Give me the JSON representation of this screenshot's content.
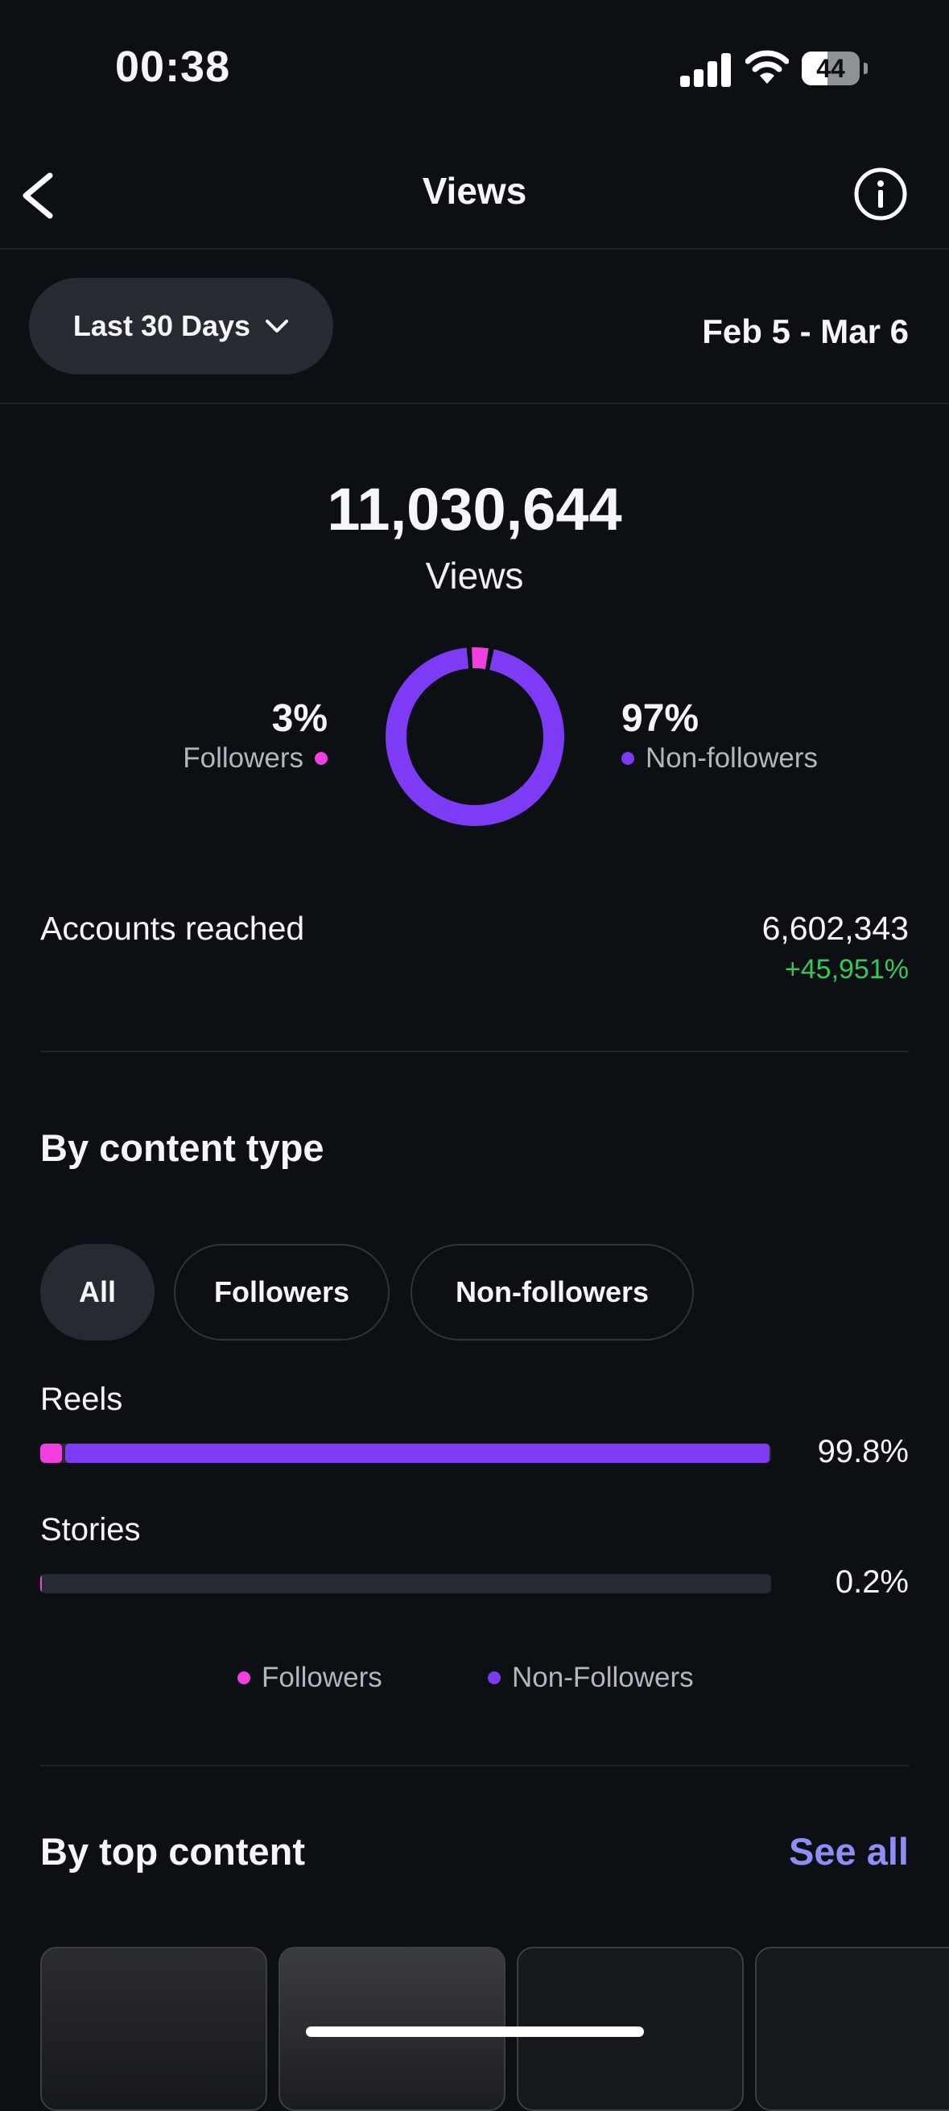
{
  "status_bar": {
    "time": "00:38",
    "battery": "44",
    "battery_level": 0.44
  },
  "nav": {
    "title": "Views"
  },
  "filters": {
    "range_label": "Last 30 Days",
    "date_range": "Feb 5 - Mar 6"
  },
  "summary": {
    "total": "11,030,644",
    "total_label": "Views",
    "followers_pct": "3%",
    "followers_label": "Followers",
    "nonfollowers_pct": "97%",
    "nonfollowers_label": "Non-followers",
    "followers_fraction": 0.03
  },
  "accounts_reached": {
    "label": "Accounts reached",
    "value": "6,602,343",
    "change": "+45,951%"
  },
  "content_type": {
    "title": "By content type",
    "chips": [
      "All",
      "Followers",
      "Non-followers"
    ],
    "rows": [
      {
        "label": "Reels",
        "pct": "99.8%",
        "total": 0.998,
        "followers_share": 0.03
      },
      {
        "label": "Stories",
        "pct": "0.2%",
        "total": 0.002,
        "followers_share": 0.5
      }
    ],
    "legend": [
      "Followers",
      "Non-Followers"
    ]
  },
  "top_content": {
    "title": "By top content",
    "see_all": "See all"
  },
  "colors": {
    "followers": "#f23fe0",
    "nonfollowers": "#7e3bf5",
    "positive": "#34c759",
    "link": "#8f8ef6"
  }
}
